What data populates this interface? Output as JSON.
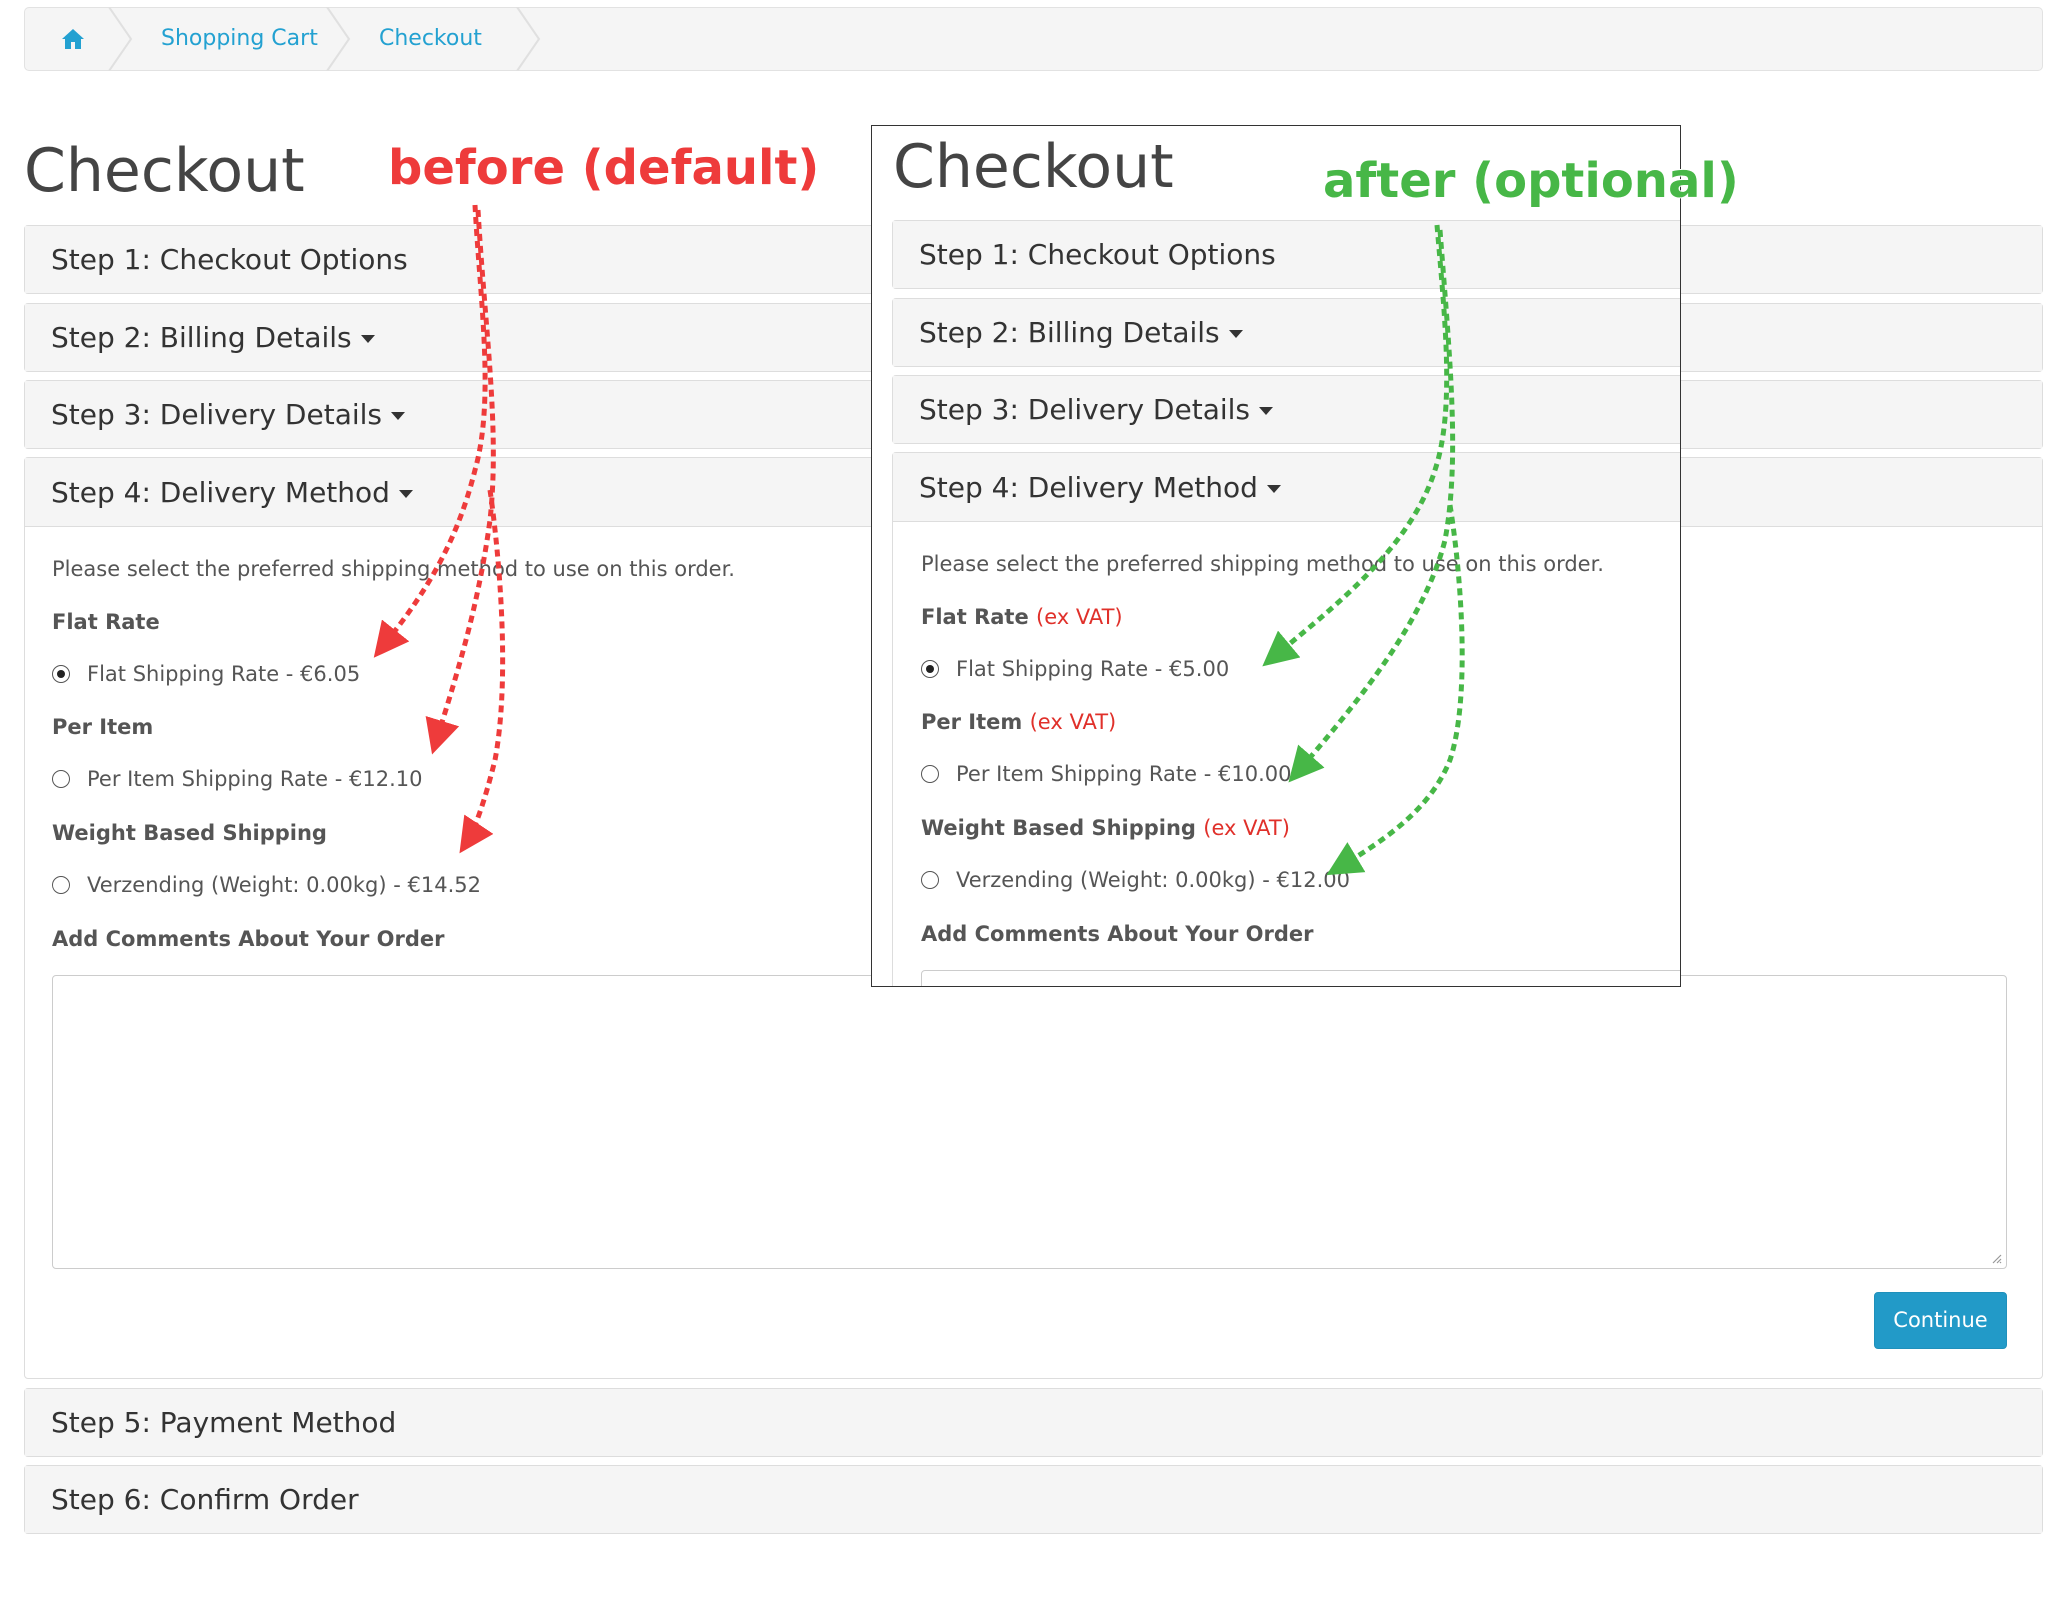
{
  "breadcrumb": {
    "items": [
      "Shopping Cart",
      "Checkout"
    ]
  },
  "left": {
    "title": "Checkout",
    "steps": [
      "Step 1: Checkout Options",
      "Step 2: Billing Details",
      "Step 3: Delivery Details",
      "Step 4: Delivery Method",
      "Step 5: Payment Method",
      "Step 6: Confirm Order"
    ],
    "intro": "Please select the preferred shipping method to use on this order.",
    "methods": [
      {
        "group": "Flat Rate",
        "option": "Flat Shipping Rate - €6.05",
        "selected": true
      },
      {
        "group": "Per Item",
        "option": "Per Item Shipping Rate - €12.10",
        "selected": false
      },
      {
        "group": "Weight Based Shipping",
        "option": "Verzending (Weight: 0.00kg) - €14.52",
        "selected": false
      }
    ],
    "comments_label": "Add Comments About Your Order",
    "continue_label": "Continue"
  },
  "right": {
    "title": "Checkout",
    "steps": [
      "Step 1: Checkout Options",
      "Step 2: Billing Details",
      "Step 3: Delivery Details",
      "Step 4: Delivery Method"
    ],
    "intro": "Please select the preferred shipping method to use on this order.",
    "vat_note": "(ex VAT)",
    "methods": [
      {
        "group": "Flat Rate",
        "option": "Flat Shipping Rate - €5.00",
        "selected": true
      },
      {
        "group": "Per Item",
        "option": "Per Item Shipping Rate - €10.00",
        "selected": false
      },
      {
        "group": "Weight Based Shipping",
        "option": "Verzending (Weight: 0.00kg) - €12.00",
        "selected": false
      }
    ],
    "comments_label": "Add Comments About Your Order"
  },
  "annotations": {
    "before": "before (default)",
    "after": "after (optional)",
    "before_color": "#ee3b3b",
    "after_color": "#47b747"
  },
  "colors": {
    "link": "#23a1d1",
    "vat": "#e0302a",
    "button": "#229ac8"
  }
}
